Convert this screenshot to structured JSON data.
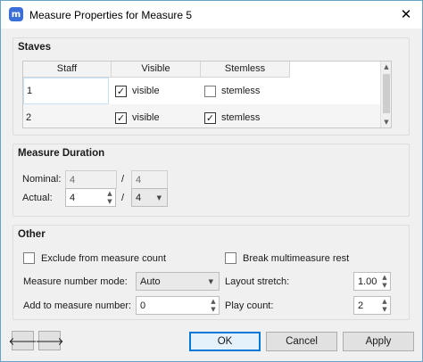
{
  "window": {
    "title": "Measure Properties for Measure 5",
    "app_icon_text": "m",
    "close_symbol": "✕"
  },
  "staves": {
    "group_title": "Staves",
    "columns": [
      "Staff",
      "Visible",
      "Stemless"
    ],
    "rows": [
      {
        "staff": "1",
        "visible_label": "visible",
        "visible_checked": true,
        "stemless_label": "stemless",
        "stemless_checked": false
      },
      {
        "staff": "2",
        "visible_label": "visible",
        "visible_checked": true,
        "stemless_label": "stemless",
        "stemless_checked": true
      }
    ]
  },
  "duration": {
    "group_title": "Measure Duration",
    "nominal_label": "Nominal:",
    "nominal_numerator": "4",
    "nominal_denominator": "4",
    "actual_label": "Actual:",
    "actual_numerator": "4",
    "actual_denominator": "4",
    "separator": "/"
  },
  "other": {
    "group_title": "Other",
    "exclude_label": "Exclude from measure count",
    "exclude_checked": false,
    "break_rest_label": "Break multimeasure rest",
    "break_rest_checked": false,
    "number_mode_label": "Measure number mode:",
    "number_mode_value": "Auto",
    "layout_stretch_label": "Layout stretch:",
    "layout_stretch_value": "1.00",
    "add_to_number_label": "Add to measure number:",
    "add_to_number_value": "0",
    "play_count_label": "Play count:",
    "play_count_value": "2"
  },
  "buttons": {
    "previous_symbol": "🡐",
    "next_symbol": "🡒",
    "ok": "OK",
    "cancel": "Cancel",
    "apply": "Apply"
  }
}
